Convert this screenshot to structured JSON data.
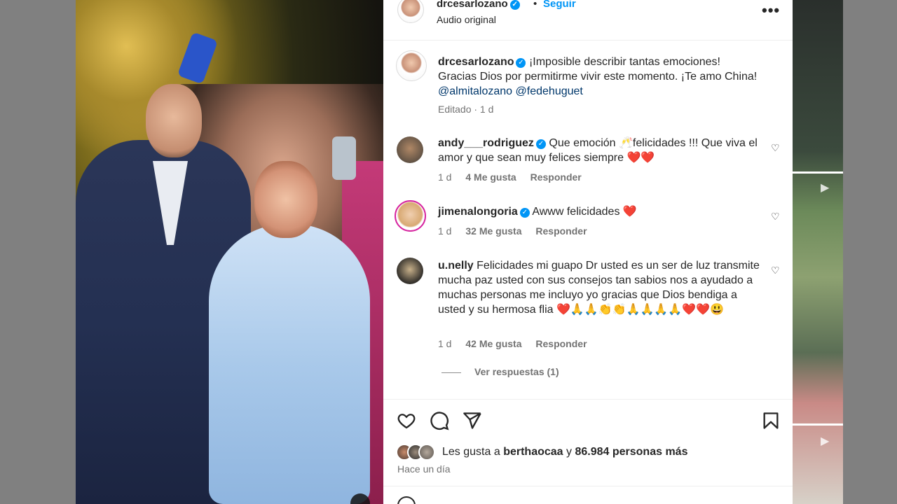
{
  "post": {
    "username": "drcesarlozano",
    "follow_label": "Seguir",
    "separator": "•",
    "audio": "Audio original",
    "more_label": "•••"
  },
  "caption": {
    "username": "drcesarlozano",
    "text": "¡Imposible describir tantas emociones! Gracias Dios por permitirme vivir este momento. ¡Te amo China!",
    "mentions": [
      "@almitalozano",
      "@fedehuguet"
    ],
    "meta": "Editado · 1 d"
  },
  "comments": [
    {
      "username": "andy___rodriguez",
      "verified": true,
      "text": "Que emoción 🥂felicidades !!! Que viva el amor y que sean muy felices siempre ❤️❤️",
      "time": "1 d",
      "likes": "4 Me gusta",
      "reply": "Responder"
    },
    {
      "username": "jimenalongoria",
      "verified": true,
      "text": "Awww felicidades ❤️",
      "time": "1 d",
      "likes": "32 Me gusta",
      "reply": "Responder"
    },
    {
      "username": "u.nelly",
      "verified": false,
      "text": "Felicidades mi guapo Dr usted es un ser de luz transmite mucha paz usted con sus consejos tan sabios nos a ayudado a muchas personas me incluyo yo gracias que Dios bendiga a usted y su hermosa flia ❤️🙏🙏👏👏🙏🙏🙏🙏❤️❤️😃",
      "time": "1 d",
      "likes": "42 Me gusta",
      "reply": "Responder",
      "view_replies": "Ver respuestas (1)"
    }
  ],
  "likes": {
    "prefix": "Les gusta a",
    "user": "berthaocaa",
    "joiner": "y",
    "count": "86.984 personas más"
  },
  "time_ago": "Hace un día",
  "icons": {
    "like": "heart-icon",
    "comment": "comment-icon",
    "share": "send-icon",
    "save": "bookmark-icon"
  },
  "colors": {
    "accent": "#0095f6",
    "mention": "#00376b",
    "secondary_text": "#737373"
  }
}
